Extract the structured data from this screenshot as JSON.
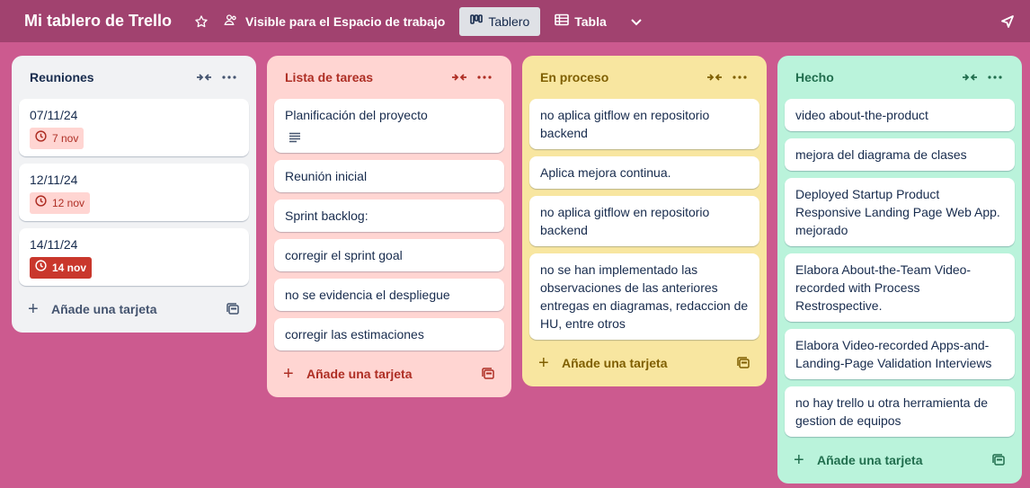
{
  "topbar": {
    "board_title": "Mi tablero de Trello",
    "visibility_label": "Visible para el Espacio de trabajo",
    "view_board_label": "Tablero",
    "view_table_label": "Tabla"
  },
  "lists": [
    {
      "name": "Reuniones",
      "add_label": "Añade una tarjeta",
      "cards": [
        {
          "title": "07/11/24",
          "badge": "7 nov"
        },
        {
          "title": "12/11/24",
          "badge": "12 nov"
        },
        {
          "title": "14/11/24",
          "badge": "14 nov"
        }
      ]
    },
    {
      "name": "Lista de tareas",
      "add_label": "Añade una tarjeta",
      "cards": [
        {
          "title": "Planificación del proyecto"
        },
        {
          "title": "Reunión inicial"
        },
        {
          "title": "Sprint backlog:"
        },
        {
          "title": "corregir el sprint goal"
        },
        {
          "title": "no se evidencia el despliegue"
        },
        {
          "title": "corregir las estimaciones"
        }
      ]
    },
    {
      "name": "En proceso",
      "add_label": "Añade una tarjeta",
      "cards": [
        {
          "title": "no aplica gitflow en repositorio backend"
        },
        {
          "title": "Aplica mejora continua."
        },
        {
          "title": "no aplica gitflow en repositorio backend"
        },
        {
          "title": "no se han implementado las observaciones de las anteriores entregas en diagramas, redaccion de HU, entre otros"
        }
      ]
    },
    {
      "name": "Hecho",
      "add_label": "Añade una tarjeta",
      "cards": [
        {
          "title": "video about-the-product"
        },
        {
          "title": "mejora del diagrama de clases"
        },
        {
          "title": "Deployed Startup Product Responsive Landing Page Web App. mejorado"
        },
        {
          "title": "Elabora About-the-Team Video-recorded with Process Restrospective."
        },
        {
          "title": "Elabora Video-recorded Apps-and-Landing-Page Validation Interviews"
        },
        {
          "title": "no hay trello u otra herramienta de gestion de equipos"
        }
      ]
    }
  ],
  "colors": {
    "board_bg": "#cc5a8f",
    "topbar_bg": "#a1426f",
    "list_reuniones": "#f1f2f4",
    "list_tareas": "#ffd5d2",
    "list_proceso": "#f8e6a0",
    "list_hecho": "#baf3db",
    "due_badge": "#c9372c"
  },
  "icons": [
    "star-icon",
    "people-icon",
    "board-icon",
    "table-icon",
    "chevron-down-icon",
    "send-icon",
    "collapse-icon",
    "more-icon",
    "clock-icon",
    "description-icon",
    "plus-icon",
    "template-icon"
  ]
}
